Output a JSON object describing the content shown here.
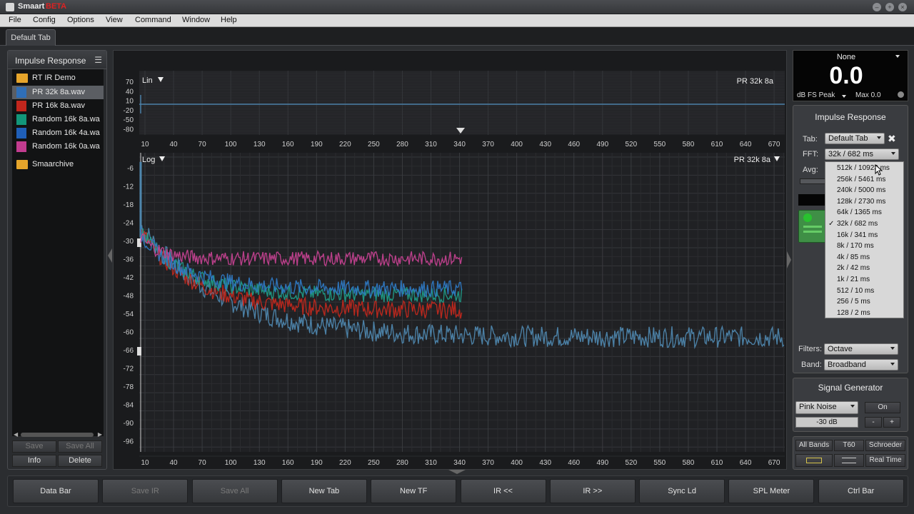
{
  "window": {
    "title": "Smaart",
    "beta_label": "BETA"
  },
  "menu": [
    "File",
    "Config",
    "Options",
    "View",
    "Command",
    "Window",
    "Help"
  ],
  "tabs": [
    {
      "label": "Default Tab"
    }
  ],
  "left_panel": {
    "title": "Impulse Response",
    "items": [
      {
        "label": "RT IR Demo",
        "icon": "folder-icon",
        "color": "#e6a52b"
      },
      {
        "label": "PR 32k 8a.wav",
        "icon": "file-icon",
        "color": "#2f6fb8",
        "selected": true
      },
      {
        "label": "PR 16k 8a.wav",
        "icon": "file-icon",
        "color": "#c2261d"
      },
      {
        "label": "Random 16k 8a.wa",
        "icon": "file-icon",
        "color": "#12967a"
      },
      {
        "label": "Random 16k 4a.wa",
        "icon": "file-icon",
        "color": "#1f5fb8"
      },
      {
        "label": "Random 16k 0a.wa",
        "icon": "file-icon",
        "color": "#c23c8f"
      },
      {
        "label": "Smaarchive",
        "icon": "folder-icon",
        "color": "#e6a52b"
      }
    ],
    "buttons": {
      "save": "Save",
      "save_all": "Save All",
      "info": "Info",
      "delete": "Delete"
    }
  },
  "top_plot": {
    "scale_label": "Lin",
    "trace_label": "PR 32k 8a",
    "y_ticks": [
      "70",
      "40",
      "10",
      "-20",
      "-50",
      "-80"
    ],
    "x_ticks": [
      "10",
      "40",
      "70",
      "100",
      "130",
      "160",
      "190",
      "220",
      "250",
      "280",
      "310",
      "340",
      "370",
      "400",
      "430",
      "460",
      "490",
      "520",
      "550",
      "580",
      "610",
      "640",
      "670"
    ]
  },
  "main_plot": {
    "scale_label": "Log",
    "trace_label": "PR 32k 8a",
    "y_ticks": [
      "-6",
      "-12",
      "-18",
      "-24",
      "-30",
      "-36",
      "-42",
      "-48",
      "-54",
      "-60",
      "-66",
      "-72",
      "-78",
      "-84",
      "-90",
      "-96"
    ],
    "x_ticks": [
      "10",
      "40",
      "70",
      "100",
      "130",
      "160",
      "190",
      "220",
      "250",
      "280",
      "310",
      "340",
      "370",
      "400",
      "430",
      "460",
      "490",
      "520",
      "550",
      "580",
      "610",
      "640",
      "670"
    ],
    "colors": {
      "pink": "#c2418f",
      "blue": "#2e78c2",
      "teal": "#1f9a86",
      "red": "#c0281e",
      "steel": "#4e86ad"
    }
  },
  "meter": {
    "source": "None",
    "value": "0.0",
    "unit": "dB FS Peak",
    "max": "Max 0.0"
  },
  "ir_panel": {
    "title": "Impulse Response",
    "tab_label": "Tab:",
    "tab_value": "Default Tab",
    "fft_label": "FFT:",
    "fft_value": "32k / 682 ms",
    "avg_label": "Avg:",
    "fft_options": [
      "512k / 10923 ms",
      "256k / 5461 ms",
      "240k / 5000 ms",
      "128k / 2730 ms",
      "64k / 1365 ms",
      "32k / 682 ms",
      "16k / 341 ms",
      "8k / 170 ms",
      "4k / 85 ms",
      "2k / 42 ms",
      "1k / 21 ms",
      "512 / 10 ms",
      "256 / 5 ms",
      "128 / 2 ms"
    ],
    "fft_selected": "32k / 682 ms",
    "filters_label": "Filters:",
    "filters_value": "Octave",
    "band_label": "Band:",
    "band_value": "Broadband"
  },
  "signal_generator": {
    "title": "Signal Generator",
    "type": "Pink Noise",
    "on_label": "On",
    "level": "-30 dB",
    "minus": "-",
    "plus": "+"
  },
  "decay_buttons": {
    "all_bands": "All Bands",
    "t60": "T60",
    "schroeder": "Schroeder",
    "real_time": "Real Time"
  },
  "bottom_bar": [
    {
      "label": "Data Bar",
      "enabled": true
    },
    {
      "label": "Save IR",
      "enabled": false
    },
    {
      "label": "Save All",
      "enabled": false
    },
    {
      "label": "New Tab",
      "enabled": true
    },
    {
      "label": "New TF",
      "enabled": true
    },
    {
      "label": "IR <<",
      "enabled": true
    },
    {
      "label": "IR >>",
      "enabled": true
    },
    {
      "label": "Sync Ld",
      "enabled": true
    },
    {
      "label": "SPL Meter",
      "enabled": true
    },
    {
      "label": "Ctrl Bar",
      "enabled": true
    }
  ]
}
